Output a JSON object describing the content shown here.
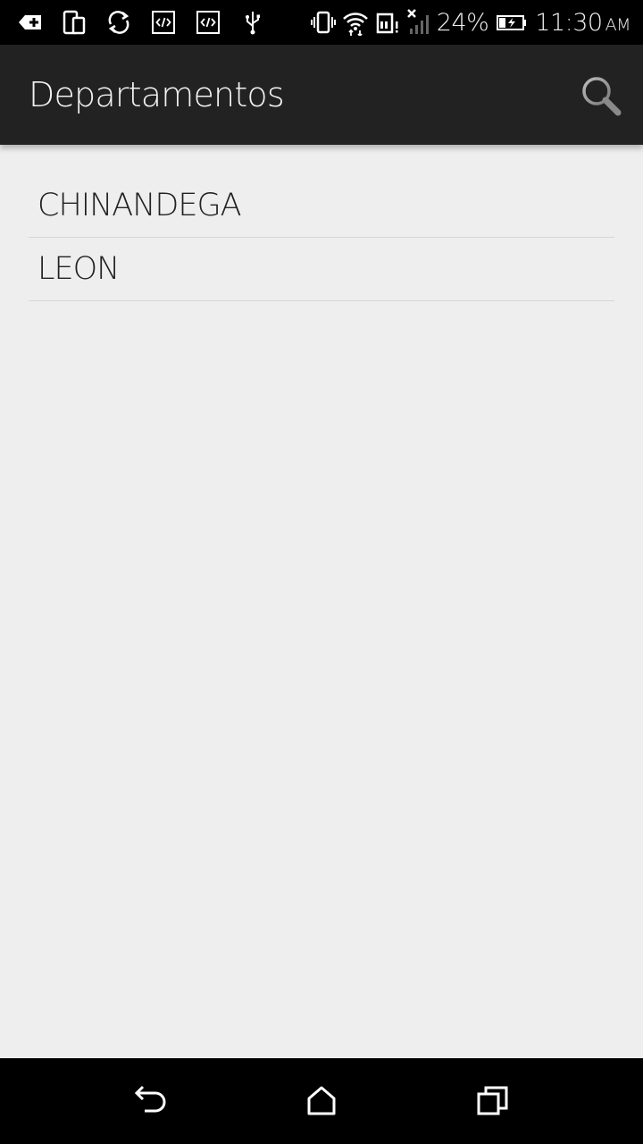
{
  "status_bar": {
    "icons_left": [
      "add-notification-icon",
      "devices-icon",
      "sync-icon",
      "code-icon",
      "code-icon",
      "usb-icon"
    ],
    "icons_right": [
      "vibrate-icon",
      "wifi-icon",
      "sd-card-icon",
      "no-signal-icon",
      "battery-charging-icon"
    ],
    "battery_percent": "24%",
    "time": "11:30",
    "ampm": "AM"
  },
  "action_bar": {
    "title": "Departamentos",
    "search_icon": "search-icon"
  },
  "list": {
    "items": [
      {
        "label": "CHINANDEGA"
      },
      {
        "label": "LEON"
      }
    ]
  },
  "nav_bar": {
    "buttons": [
      "back-icon",
      "home-icon",
      "recent-apps-icon"
    ]
  },
  "colors": {
    "action_bar_bg": "#222222",
    "content_bg": "#eeeeee",
    "status_bar_bg": "#000000",
    "nav_bar_bg": "#000000",
    "divider": "#d5d5d5"
  }
}
